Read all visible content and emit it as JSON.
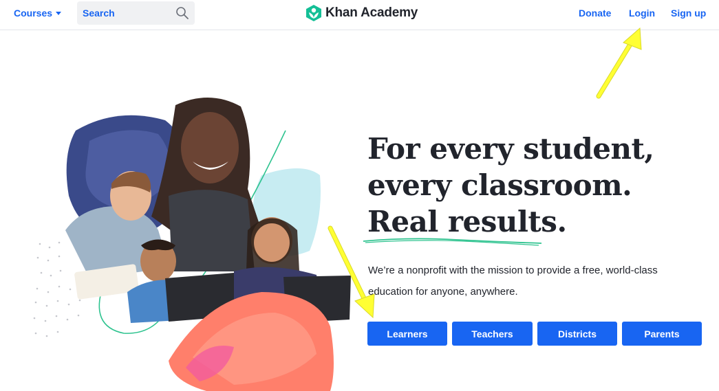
{
  "header": {
    "courses_label": "Courses",
    "search_placeholder": "Search",
    "brand": "Khan Academy",
    "donate_label": "Donate",
    "login_label": "Login",
    "signup_label": "Sign up"
  },
  "hero": {
    "title_line1": "For every student,",
    "title_line2": "every classroom.",
    "title_line3": "Real results.",
    "subtitle": "We’re a nonprofit with the mission to provide a free, world-class education for anyone, anywhere."
  },
  "buttons": {
    "learners": "Learners",
    "teachers": "Teachers",
    "districts": "Districts",
    "parents": "Parents"
  },
  "colors": {
    "brand_blue": "#1865f2",
    "logo_green": "#14bf96",
    "annotation_yellow": "#ffff33"
  },
  "icons": [
    "chevron-down-icon",
    "search-icon",
    "khan-logo-icon",
    "arrow-annotation"
  ]
}
